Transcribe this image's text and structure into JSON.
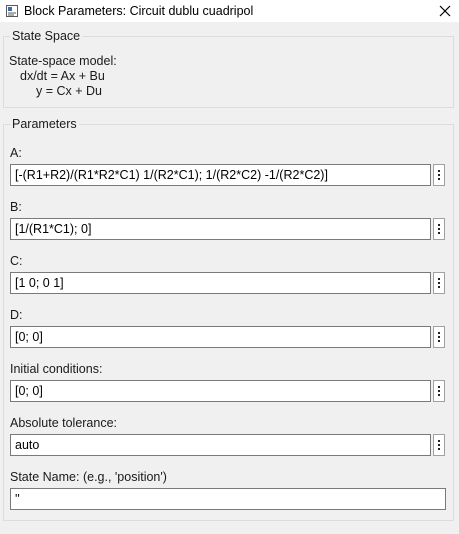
{
  "window": {
    "title": "Block Parameters: Circuit dublu cuadripol",
    "icons": {
      "app": "block-parameters-icon",
      "close": "close-icon",
      "more": "more-options-icon"
    }
  },
  "state_space": {
    "section_title": "State Space",
    "description": [
      "State-space model:",
      "dx/dt = Ax + Bu",
      "y = Cx + Du"
    ]
  },
  "parameters": {
    "section_title": "Parameters",
    "fields": [
      {
        "label": "A:",
        "value": "[-(R1+R2)/(R1*R2*C1) 1/(R2*C1); 1/(R2*C2) -1/(R2*C2)]"
      },
      {
        "label": "B:",
        "value": "[1/(R1*C1); 0]"
      },
      {
        "label": "C:",
        "value": "[1 0; 0 1]"
      },
      {
        "label": "D:",
        "value": "[0; 0]"
      },
      {
        "label": "Initial conditions:",
        "value": "[0; 0]"
      },
      {
        "label": "Absolute tolerance:",
        "value": "auto"
      },
      {
        "label": "State Name: (e.g., 'position')",
        "value": "''"
      }
    ]
  }
}
